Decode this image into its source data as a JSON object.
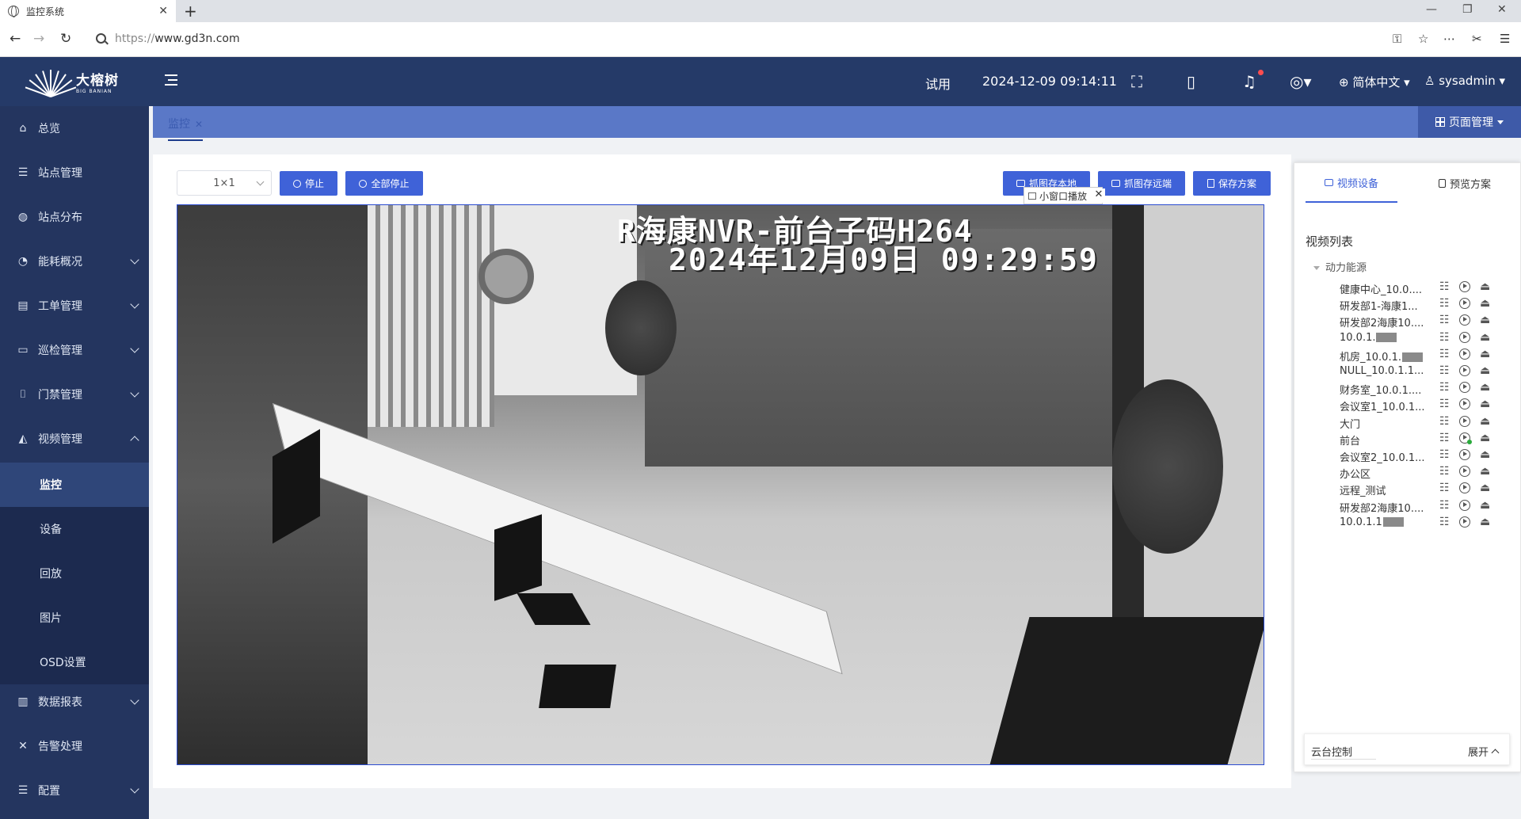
{
  "browser": {
    "tab_title": "监控系统",
    "url_scheme": "https://",
    "url_host": "www.gd3n.com"
  },
  "header": {
    "brand_cn": "大榕树",
    "brand_en": "BIG BANIAN",
    "trial": "试用",
    "datetime": "2024-12-09 09:14:11",
    "language": "简体中文",
    "user": "sysadmin"
  },
  "sidebar": {
    "items": [
      {
        "label": "总览",
        "icon": "home-icon"
      },
      {
        "label": "站点管理",
        "icon": "database-icon"
      },
      {
        "label": "站点分布",
        "icon": "map-icon"
      },
      {
        "label": "能耗概况",
        "icon": "pie-icon"
      },
      {
        "label": "工单管理",
        "icon": "clipboard-icon"
      },
      {
        "label": "巡检管理",
        "icon": "monitor-icon"
      },
      {
        "label": "门禁管理",
        "icon": "door-icon"
      },
      {
        "label": "视频管理",
        "icon": "camera-icon"
      },
      {
        "label": "数据报表",
        "icon": "bar-chart-icon"
      },
      {
        "label": "告警处理",
        "icon": "alarm-icon"
      },
      {
        "label": "配置",
        "icon": "config-icon"
      }
    ],
    "video_sub": [
      "监控",
      "设备",
      "回放",
      "图片",
      "OSD设置"
    ]
  },
  "tabstrip": {
    "crumb": "监控",
    "page_manage": "页面管理"
  },
  "toolbar": {
    "layout_value": "1×1",
    "stop": "停止",
    "stop_all": "全部停止",
    "snap_local": "抓图存本地",
    "snap_remote": "抓图存远端",
    "save_plan": "保存方案"
  },
  "video": {
    "osd_line1": "R海康NVR-前台子码H264",
    "osd_line2": "2024年12月09日 09:29:59",
    "mini_window": "小窗口播放"
  },
  "right_panel": {
    "tab_devices": "视频设备",
    "tab_plans": "预览方案",
    "list_title": "视频列表",
    "group": "动力能源",
    "devices": [
      {
        "label": "健康中心_10.0....",
        "masked": false,
        "playing": false
      },
      {
        "label": "研发部1-海康1...",
        "masked": false,
        "playing": false
      },
      {
        "label": "研发部2海康10....",
        "masked": false,
        "playing": false
      },
      {
        "label": "10.0.1.",
        "masked": true,
        "playing": false
      },
      {
        "label": "机房_10.0.1.",
        "masked": true,
        "playing": false
      },
      {
        "label": "NULL_10.0.1.1...",
        "masked": false,
        "playing": false
      },
      {
        "label": "财务室_10.0.1....",
        "masked": false,
        "playing": false
      },
      {
        "label": "会议室1_10.0.1...",
        "masked": false,
        "playing": false
      },
      {
        "label": "大门",
        "masked": false,
        "playing": false
      },
      {
        "label": "前台",
        "masked": false,
        "playing": true
      },
      {
        "label": "会议室2_10.0.1...",
        "masked": false,
        "playing": false
      },
      {
        "label": "办公区",
        "masked": false,
        "playing": false
      },
      {
        "label": "远程_测试",
        "masked": false,
        "playing": false
      },
      {
        "label": "研发部2海康10....",
        "masked": false,
        "playing": false
      },
      {
        "label": "10.0.1.1",
        "masked": true,
        "playing": false
      }
    ],
    "ptz_label": "云台控制",
    "ptz_expand": "展开"
  }
}
